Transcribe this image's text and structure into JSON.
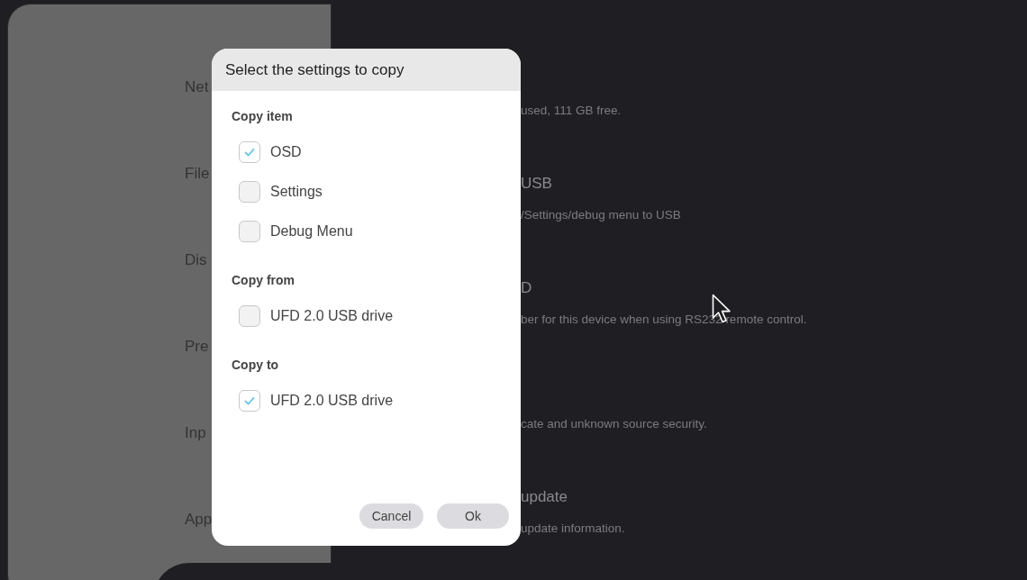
{
  "sidebar": {
    "items": [
      {
        "label": "Net"
      },
      {
        "label": "File"
      },
      {
        "label": "Dis"
      },
      {
        "label": "Pre"
      },
      {
        "label": "Inp"
      },
      {
        "label": "App"
      }
    ]
  },
  "content": {
    "items": [
      {
        "description": "used, 111 GB free."
      },
      {
        "title": "USB",
        "description": "/Settings/debug menu to USB"
      },
      {
        "title": "D",
        "description": "ber for this device when using RS232 remote control."
      },
      {
        "description": "cate and unknown source security."
      },
      {
        "title": "update",
        "description": "update information."
      }
    ]
  },
  "dialog": {
    "title": "Select the settings to copy",
    "sections": [
      {
        "heading": "Copy item",
        "options": [
          {
            "label": "OSD",
            "checked": true
          },
          {
            "label": "Settings",
            "checked": false
          },
          {
            "label": "Debug Menu",
            "checked": false
          }
        ]
      },
      {
        "heading": "Copy from",
        "options": [
          {
            "label": "UFD 2.0 USB drive",
            "checked": false
          }
        ]
      },
      {
        "heading": "Copy to",
        "options": [
          {
            "label": "UFD 2.0 USB drive",
            "checked": true
          }
        ]
      }
    ],
    "buttons": [
      {
        "label": "Cancel"
      },
      {
        "label": "Ok"
      }
    ]
  }
}
